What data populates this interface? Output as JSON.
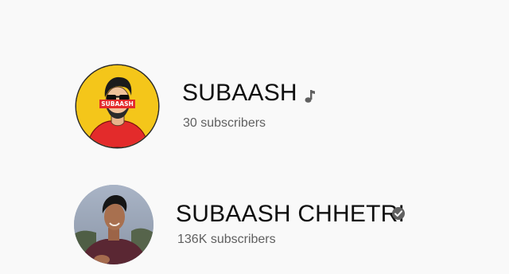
{
  "channels": [
    {
      "name": "SUBAASH",
      "subscribers": "30 subscribers",
      "avatar_text": "SUBAASH",
      "badge_icon": "music-note-icon"
    },
    {
      "name": "SUBAASH CHHETRI",
      "subscribers": "136K subscribers",
      "badge_icon": "verified-check-icon"
    }
  ],
  "colors": {
    "page_background": "#f9f9f9",
    "name_text": "#0f0f0f",
    "subscriber_text": "#606060",
    "avatar_yellow": "#f4c61a",
    "avatar_red": "#e32b2b",
    "badge_gray": "#606060"
  }
}
